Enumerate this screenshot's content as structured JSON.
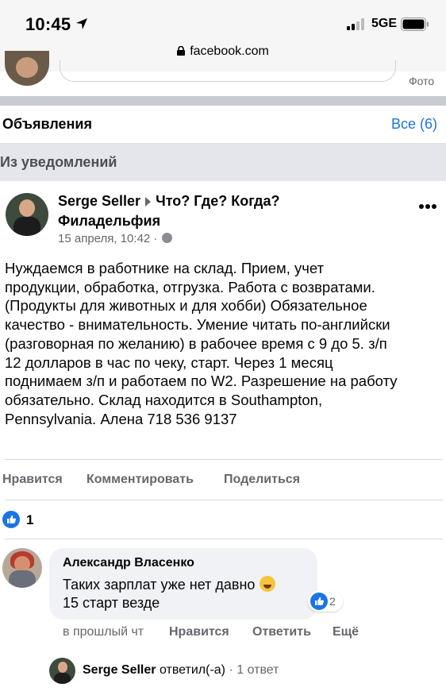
{
  "status_bar": {
    "time": "10:45",
    "network": "5GE",
    "url": "facebook.com"
  },
  "composer": {
    "photo_label": "Фото"
  },
  "announcements": {
    "title": "Объявления",
    "see_all": "Все (6)"
  },
  "section_label": "Из уведомлений",
  "post": {
    "author": "Serge Seller",
    "group": "Что? Где? Когда?",
    "group_city": "Филадельфия",
    "timestamp": "15 апреля, 10:42 ·",
    "text_lines": [
      "Нуждаемся в работнике на склад. Прием, учет",
      "продукции, обработка, отгрузка. Работа с возвратами.",
      "(Продукты для животных и для хобби) Обязательное",
      "качество - внимательность. Умение читать по-английски",
      "(разговорная по желанию) в рабочее время с 9 до 5. з/п",
      "12 долларов в час по чеку, старт. Через 1 месяц",
      "поднимаем з/п и работаем по W2. Разрешение на работу",
      "обязательно. Склад находится в Southampton,",
      "Pennsylvania. Алена 718 536 9137"
    ],
    "actions": {
      "like": "Нравится",
      "comment": "Комментировать",
      "share": "Поделиться"
    },
    "like_count": "1"
  },
  "comment": {
    "author": "Александр Власенко",
    "text_line1": "Таких зарплат уже нет давно",
    "text_line2": "15 старт везде",
    "reaction_count": "2",
    "time": "в прошлый чт",
    "like": "Нравится",
    "reply": "Ответить",
    "more": "Ещё"
  },
  "reply_summary": {
    "author": "Serge Seller",
    "verb": "ответил(-а)",
    "count": "· 1 ответ"
  },
  "colors": {
    "facebook_blue": "#1b74e4",
    "secondary_text": "#65676b",
    "bubble_bg": "#f0f2f5"
  }
}
